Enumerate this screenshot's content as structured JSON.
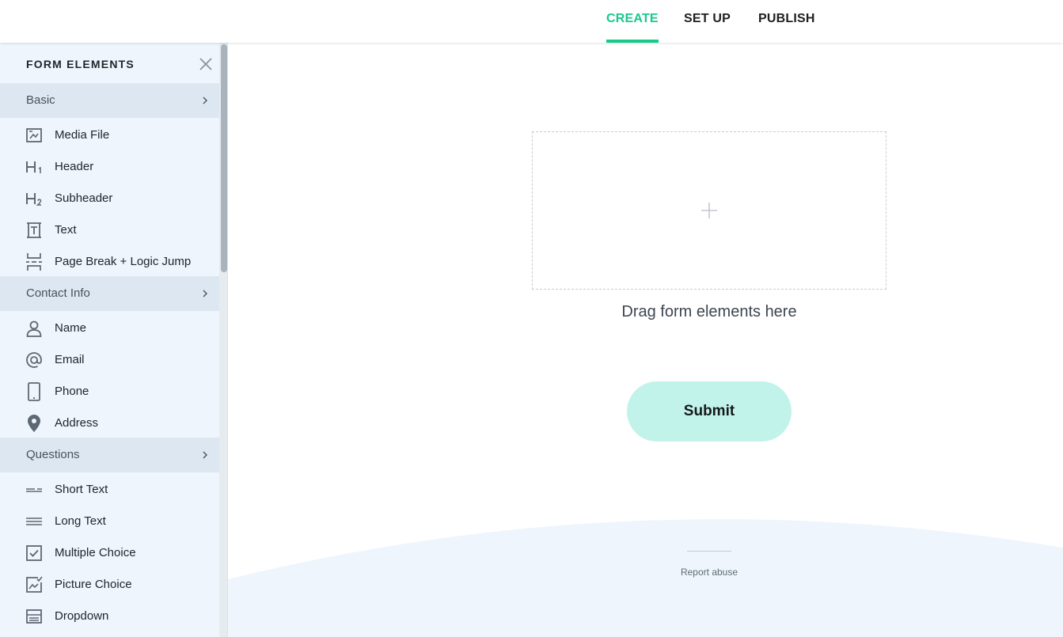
{
  "nav": {
    "tabs": [
      {
        "label": "CREATE",
        "active": true
      },
      {
        "label": "SET UP",
        "active": false
      },
      {
        "label": "PUBLISH",
        "active": false
      }
    ],
    "accent_color": "#19c98a"
  },
  "sidebar": {
    "title": "FORM ELEMENTS",
    "sections": [
      {
        "label": "Basic",
        "items": [
          {
            "label": "Media File",
            "icon": "media-file-icon"
          },
          {
            "label": "Header",
            "icon": "h1-icon"
          },
          {
            "label": "Subheader",
            "icon": "h2-icon"
          },
          {
            "label": "Text",
            "icon": "text-icon"
          },
          {
            "label": "Page Break + Logic Jump",
            "icon": "page-break-icon"
          }
        ]
      },
      {
        "label": "Contact Info",
        "items": [
          {
            "label": "Name",
            "icon": "person-icon"
          },
          {
            "label": "Email",
            "icon": "at-icon"
          },
          {
            "label": "Phone",
            "icon": "phone-icon"
          },
          {
            "label": "Address",
            "icon": "location-pin-icon"
          }
        ]
      },
      {
        "label": "Questions",
        "items": [
          {
            "label": "Short Text",
            "icon": "short-text-icon"
          },
          {
            "label": "Long Text",
            "icon": "long-text-icon"
          },
          {
            "label": "Multiple Choice",
            "icon": "checkbox-icon"
          },
          {
            "label": "Picture Choice",
            "icon": "picture-choice-icon"
          },
          {
            "label": "Dropdown",
            "icon": "dropdown-icon"
          }
        ]
      }
    ]
  },
  "canvas": {
    "drop_hint": "Drag form elements here",
    "submit_label": "Submit",
    "submit_color": "#c2f3ea",
    "report_link": "Report abuse"
  }
}
